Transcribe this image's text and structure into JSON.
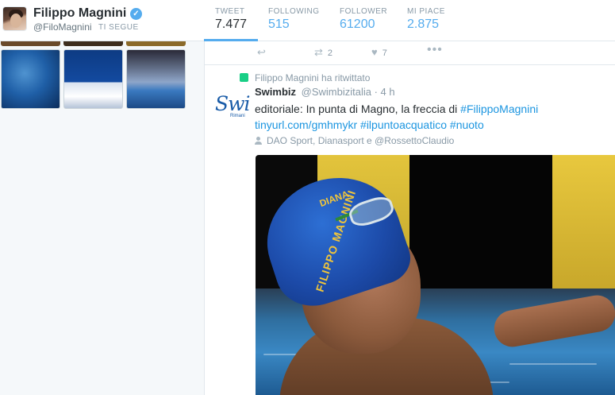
{
  "profile": {
    "name": "Filippo Magnini",
    "handle": "@FiloMagnini",
    "follows_you": "TI SEGUE"
  },
  "stats": [
    {
      "label": "TWEET",
      "value": "7.477"
    },
    {
      "label": "FOLLOWING",
      "value": "515"
    },
    {
      "label": "FOLLOWER",
      "value": "61200"
    },
    {
      "label": "MI PIACE",
      "value": "2.875"
    }
  ],
  "prev_tweet_actions": {
    "retweets": "2",
    "likes": "7",
    "more": "•••"
  },
  "tweet": {
    "retweet_context": "Filippo Magnini ha ritwittato",
    "author_avatar_text": "Swi",
    "author_avatar_sub": "Rimani",
    "author_name": "Swimbiz",
    "author_handle": "@Swimbizitalia",
    "time": "· 4 h",
    "text_plain": "editoriale: In punta di Magno, la freccia di ",
    "hashtag_1": "#FilippoMagnini",
    "link": "tinyurl.com/gmhmykr",
    "hashtag_2": "#ilpuntoacquatico",
    "hashtag_3": "#nuoto",
    "mentions": "DAO Sport, Dianasport e @RossettoClaudio",
    "photo_cap_text": "FILIPPO MAGNINI",
    "photo_cap_text2": "DIANA"
  },
  "colors": {
    "accent": "#55acee",
    "link": "#1b95e0",
    "retweet_green": "#19cf86"
  }
}
